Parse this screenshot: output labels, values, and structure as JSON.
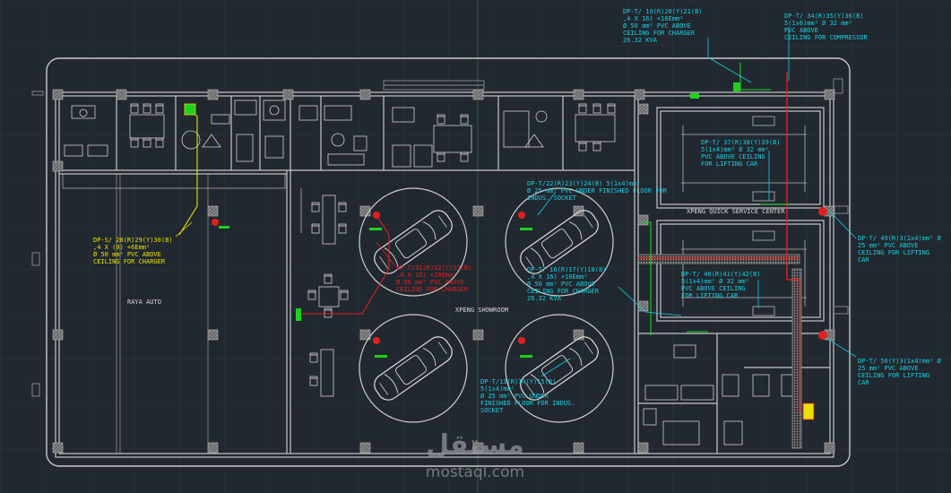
{
  "colors": {
    "background": "#212830",
    "grid": "#2a323b",
    "wall": "#c8c8c8",
    "cyan": "#18d0e0",
    "yellow": "#e8e000",
    "red": "#e02020",
    "green": "#20d020"
  },
  "rooms": {
    "raya": "RAYA AUTO",
    "showroom": "XPENG SHOWROOM",
    "service": "XPENG QUICK SERVICE CENTER"
  },
  "labels": {
    "l1": {
      "lines": [
        "DP-T/ 19(R)20(Y)21(B)",
        ",4 X 16) +16Emm²",
        "Ø 50 mm² PVC ABOVE",
        "CEILING FOR CHARGER",
        "26.32 KVA"
      ]
    },
    "l2": {
      "lines": [
        "DP-T/ 34(R)35(Y)36(B)",
        "5(1x6)mm² Ø 32 mm²",
        "PVC ABOVE",
        "CEILING FOR COMPRESSOR"
      ]
    },
    "l3": {
      "lines": [
        "DP-T/ 37(R)38(Y)39(B)",
        "5(1x4)mm² Ø 32 mm²",
        "PVC ABOVE CEILING",
        "FOR LIFTING CAR"
      ]
    },
    "l4": {
      "lines": [
        "DP-T/22(R)23(Y)24(B)  5(1x4)mm²",
        "Ø 25 mm² PVC UNDER FINISHED FLOOR FOR",
        "INDUS. SOCKET"
      ]
    },
    "l5": {
      "lines": [
        "DP-S/ 28(R)29(Y)30(B)",
        ",4 X (0) +6Emm²",
        "Ø 50 mm² PVC ABOVE",
        "CEILING FOR CHARGER"
      ]
    },
    "l6": {
      "lines": [
        "DP-T/31(R)32(Y)33(B)",
        ",4 X 16) +16Emm²",
        "Ø 50 mm² PVC ABOVE",
        "CEILING FOR CHARGER"
      ]
    },
    "l7": {
      "lines": [
        "DP-T/ 16(R)17(Y)18(B)",
        ",4 X 16) +16Emm²",
        "Ø 50 mm² PVC ABOVE",
        "CEILING FOR CHARGER",
        "26.32 KVA"
      ]
    },
    "l8": {
      "lines": [
        "DP-T/ 40(R)41(Y)42(B)",
        "5(1x4)mm² Ø 32 mm²",
        "PVC ABOVE CEILING",
        "FOR LIFTING CAR"
      ]
    },
    "l9": {
      "lines": [
        "DP-T/ 49(R)3(1x4)mm² Ø",
        "25 mm² PVC ABOVE",
        "CEILING FOR LIFTING",
        "CAR"
      ]
    },
    "l10": {
      "lines": [
        "DP-T/ 50(Y)3(1x4)mm² Ø",
        "25 mm² PVC ABOVE",
        "CEILING FOR LIFTING",
        "CAR"
      ]
    },
    "l11": {
      "lines": [
        "DP-T/13(R)14(Y)15(B)",
        "5(1x4)mm²",
        "Ø 25 mm² PVC UNDER",
        "FINISHED FLOOR FOR INDUS.",
        "SOCKET"
      ]
    }
  },
  "watermark": {
    "arabic": "مستقل",
    "latin": "mostaql.com"
  }
}
